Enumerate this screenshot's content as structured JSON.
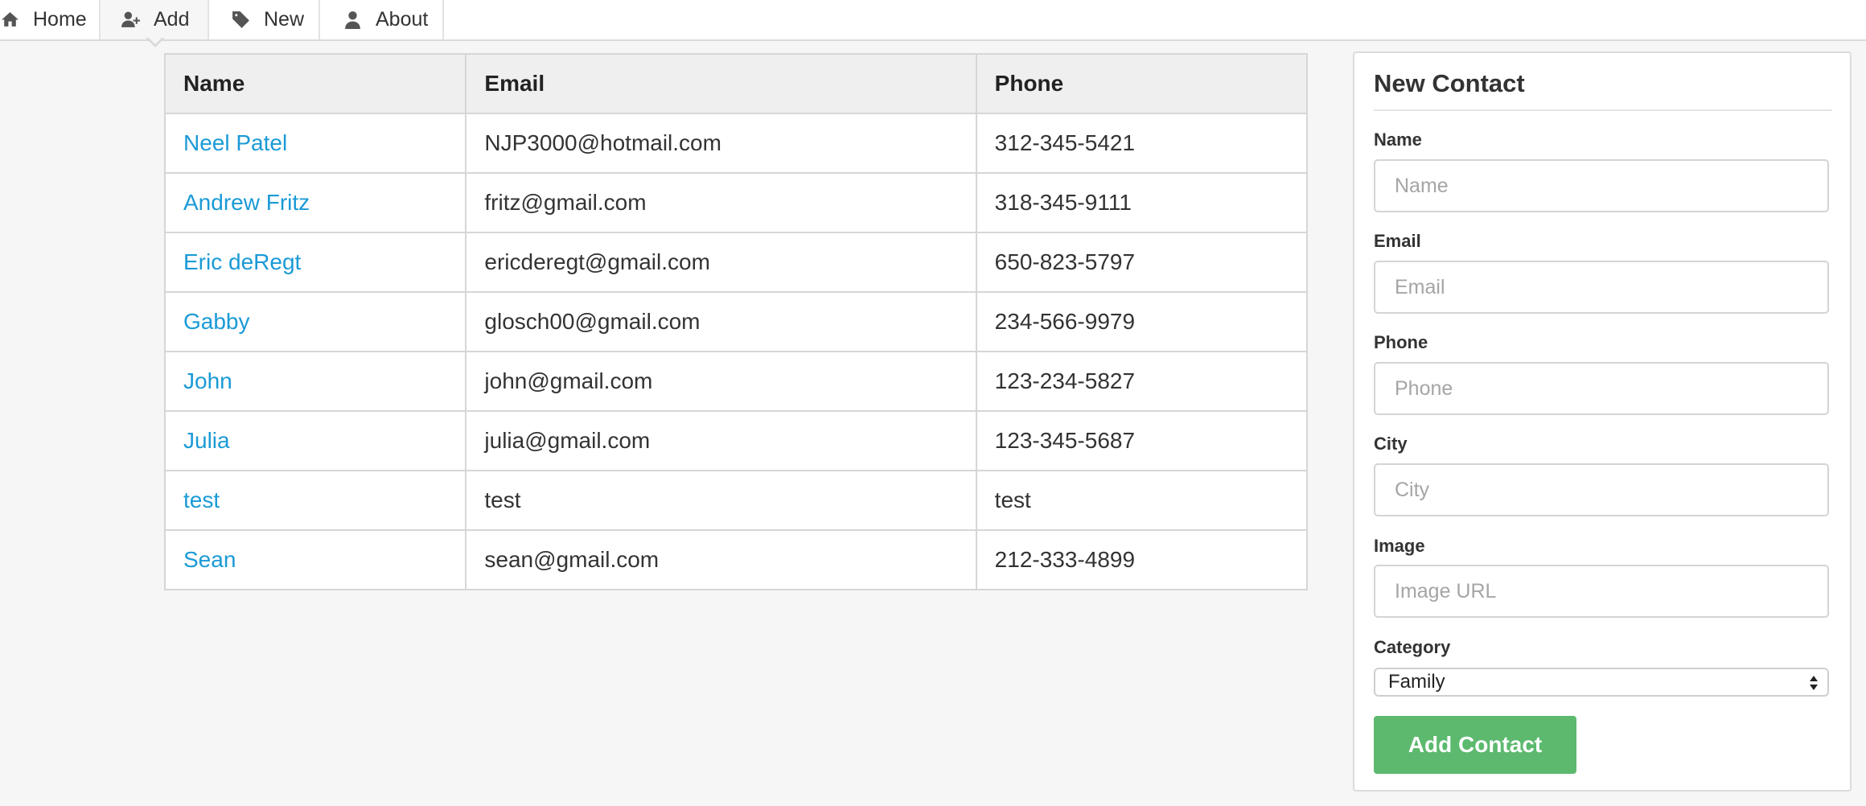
{
  "nav": {
    "items": [
      {
        "label": "Home",
        "icon": "home-icon"
      },
      {
        "label": "Add",
        "icon": "add-user-icon",
        "active": true
      },
      {
        "label": "New",
        "icon": "tag-icon"
      },
      {
        "label": "About",
        "icon": "user-icon"
      }
    ]
  },
  "table": {
    "headers": [
      "Name",
      "Email",
      "Phone"
    ],
    "rows": [
      {
        "name": "Neel Patel",
        "email": "NJP3000@hotmail.com",
        "phone": "312-345-5421"
      },
      {
        "name": "Andrew Fritz",
        "email": "fritz@gmail.com",
        "phone": "318-345-9111"
      },
      {
        "name": "Eric deRegt",
        "email": "ericderegt@gmail.com",
        "phone": "650-823-5797"
      },
      {
        "name": "Gabby",
        "email": "glosch00@gmail.com",
        "phone": "234-566-9979"
      },
      {
        "name": "John",
        "email": "john@gmail.com",
        "phone": "123-234-5827"
      },
      {
        "name": "Julia",
        "email": "julia@gmail.com",
        "phone": "123-345-5687"
      },
      {
        "name": "test",
        "email": "test",
        "phone": "test"
      },
      {
        "name": "Sean",
        "email": "sean@gmail.com",
        "phone": "212-333-4899"
      }
    ]
  },
  "form": {
    "title": "New Contact",
    "fields": [
      {
        "label": "Name",
        "placeholder": "Name",
        "value": ""
      },
      {
        "label": "Email",
        "placeholder": "Email",
        "value": ""
      },
      {
        "label": "Phone",
        "placeholder": "Phone",
        "value": ""
      },
      {
        "label": "City",
        "placeholder": "City",
        "value": ""
      },
      {
        "label": "Image",
        "placeholder": "Image URL",
        "value": ""
      }
    ],
    "category": {
      "label": "Category",
      "selected": "Family"
    },
    "submit_label": "Add Contact"
  },
  "colors": {
    "link": "#1a9ad6",
    "button": "#5cb96e",
    "background": "#f6f6f6"
  }
}
